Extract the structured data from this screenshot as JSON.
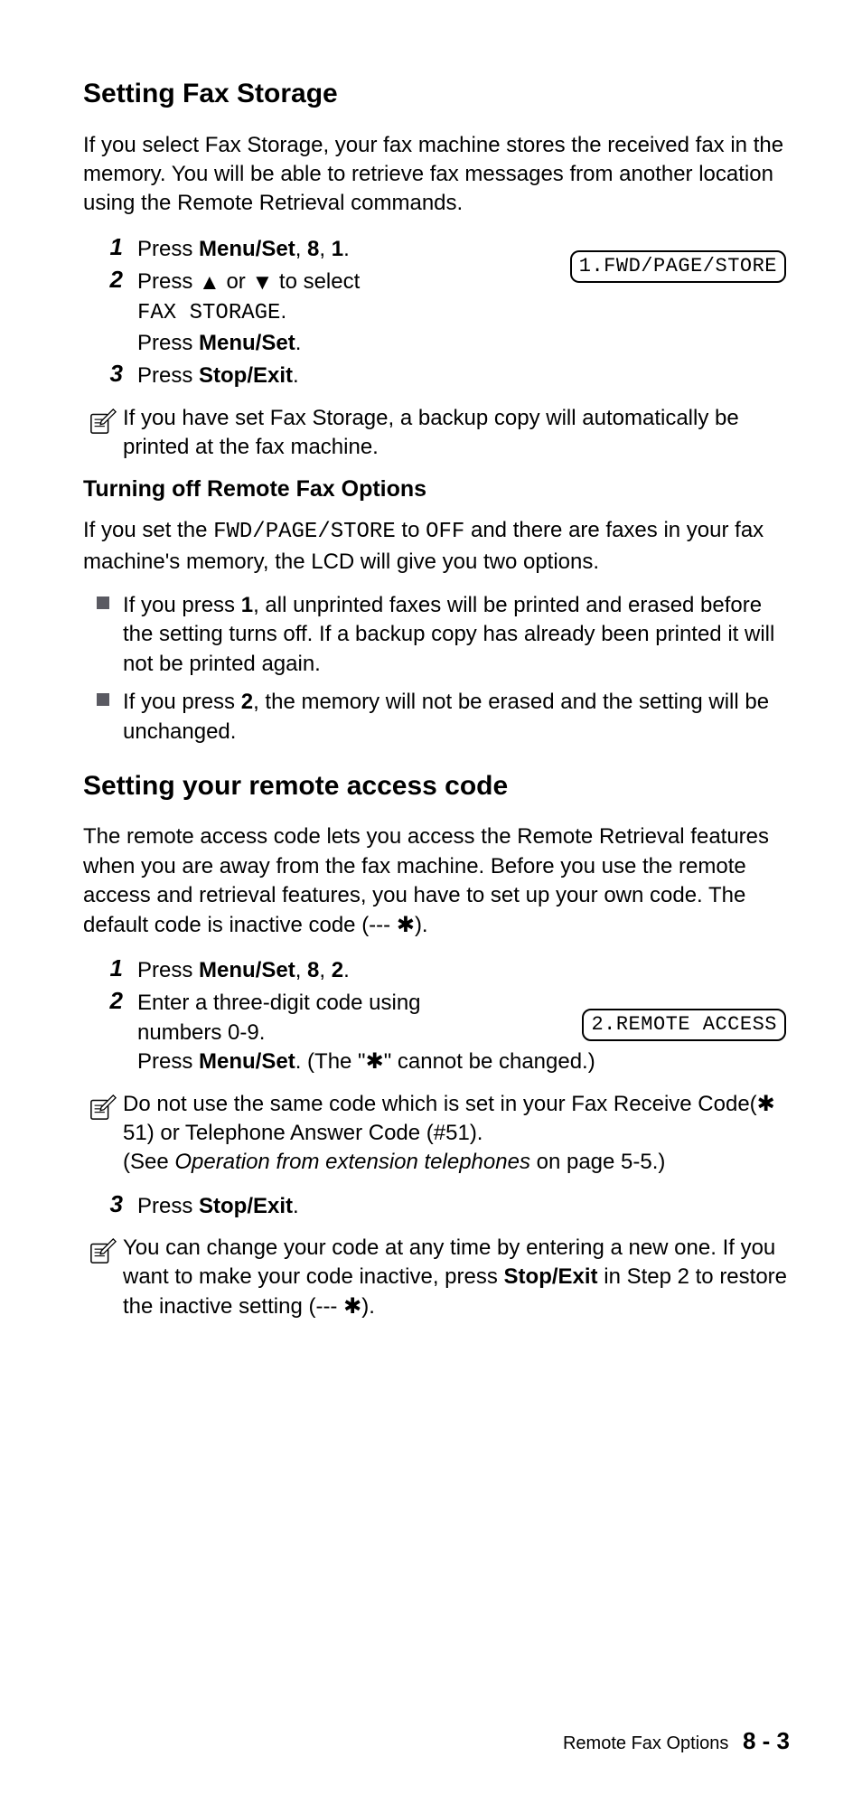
{
  "section1": {
    "title": "Setting Fax Storage",
    "intro": "If you select Fax Storage, your fax machine stores the received fax in the memory. You will be able to retrieve fax messages from another location using the Remote Retrieval commands.",
    "lcd": "1.FWD/PAGE/STORE",
    "step1": {
      "num": "1",
      "pre": "Press ",
      "menu": "Menu/Set",
      "sep1": ", ",
      "k1": "8",
      "sep2": ", ",
      "k2": "1",
      "post": "."
    },
    "step2": {
      "num": "2",
      "line1_pre": "Press ",
      "line1_mid": " or ",
      "line1_post": " to select",
      "line2_mono": "FAX STORAGE",
      "line2_post": ".",
      "line3_pre": "Press ",
      "line3_b": "Menu/Set",
      "line3_post": "."
    },
    "step3": {
      "num": "3",
      "pre": "Press ",
      "b": "Stop/Exit",
      "post": "."
    },
    "note": "If you have set Fax Storage, a backup copy will automatically be printed at the fax machine."
  },
  "sub1": {
    "title": "Turning off Remote Fax Options",
    "intro_pre": "If you set the ",
    "intro_mono1": "FWD/PAGE/STORE",
    "intro_mid": " to ",
    "intro_mono2": "OFF",
    "intro_post": " and there are faxes in your fax machine's memory, the LCD will give you two options.",
    "bullet1_pre": "If you press ",
    "bullet1_b": "1",
    "bullet1_post": ", all unprinted faxes will be printed and erased before the setting turns off. If a backup copy has already been printed it will not be printed again.",
    "bullet2_pre": "If you press ",
    "bullet2_b": "2",
    "bullet2_post": ", the memory will not be erased and the setting will be unchanged."
  },
  "section2": {
    "title": "Setting your remote access code",
    "intro_pre": "The remote access code lets you access the Remote Retrieval features when you are away from the fax machine. Before you use the remote access and retrieval features, you have to set up your own code. The default code is inactive code (--- ",
    "intro_post": ").",
    "lcd": "2.REMOTE ACCESS",
    "step1": {
      "num": "1",
      "pre": "Press ",
      "menu": "Menu/Set",
      "sep1": ", ",
      "k1": "8",
      "sep2": ", ",
      "k2": "2",
      "post": "."
    },
    "step2": {
      "num": "2",
      "line1": "Enter a three-digit code using numbers 0-9.",
      "line2_pre": "Press ",
      "line2_b": "Menu/Set",
      "line2_mid": ". (The \"",
      "line2_post": "\" cannot be changed.)"
    },
    "note1_l1_pre": "Do not use the same code which is set in your Fax Receive Code(",
    "note1_l1_mid": " 51) or Telephone Answer Code (#51).",
    "note1_l2_pre": "(See ",
    "note1_l2_i": "Operation from extension telephones",
    "note1_l2_post": " on page 5-5.)",
    "step3": {
      "num": "3",
      "pre": "Press ",
      "b": "Stop/Exit",
      "post": "."
    },
    "note2_pre": "You can change your code at any time by entering a new one. If you want to make your code inactive, press ",
    "note2_b": "Stop/Exit",
    "note2_mid": " in Step 2 to restore the inactive setting (--- ",
    "note2_post": ")."
  },
  "footer": {
    "label": "Remote Fax Options",
    "page": "8 - 3"
  },
  "glyphs": {
    "up": "▲",
    "down": "▼",
    "star": "✱"
  }
}
